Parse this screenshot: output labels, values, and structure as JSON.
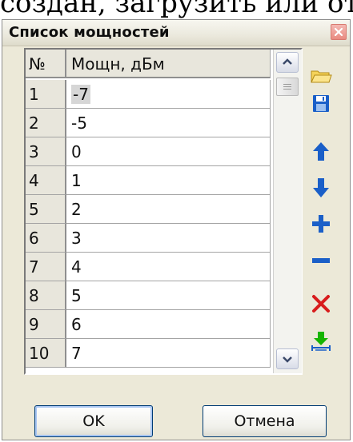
{
  "background_text": "создан, загрузить или отредактировать",
  "window": {
    "title": "Список мощностей"
  },
  "table": {
    "columns": [
      "№",
      "Мощн, дБм"
    ],
    "rows": [
      {
        "n": "1",
        "v": "-7"
      },
      {
        "n": "2",
        "v": "-5"
      },
      {
        "n": "3",
        "v": "0"
      },
      {
        "n": "4",
        "v": "1"
      },
      {
        "n": "5",
        "v": "2"
      },
      {
        "n": "6",
        "v": "3"
      },
      {
        "n": "7",
        "v": "4"
      },
      {
        "n": "8",
        "v": "5"
      },
      {
        "n": "9",
        "v": "6"
      },
      {
        "n": "10",
        "v": "7"
      }
    ],
    "selected_row": "1"
  },
  "toolbar": [
    "open-folder-icon",
    "save-icon",
    "move-up-icon",
    "move-down-icon",
    "add-icon",
    "remove-icon",
    "delete-all-icon",
    "interpolate-icon"
  ],
  "buttons": {
    "ok": "OK",
    "cancel": "Отмена"
  },
  "colors": {
    "icon_blue": "#1a5fc8",
    "icon_red": "#d81c1c",
    "icon_green": "#16b400",
    "folder_yellow": "#f5d35a"
  }
}
